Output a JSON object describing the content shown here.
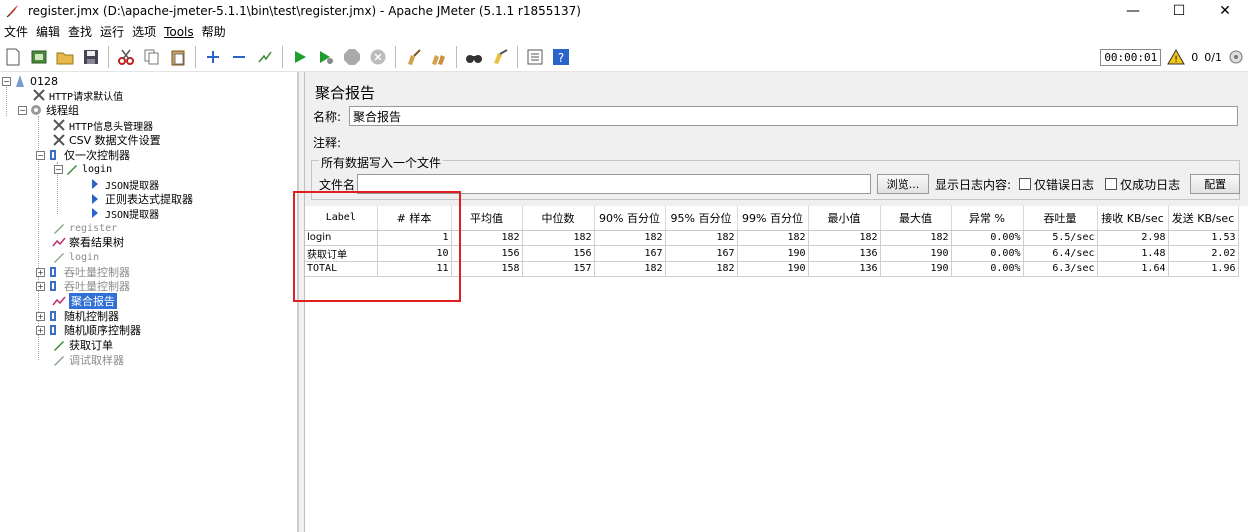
{
  "window": {
    "title": "register.jmx (D:\\apache-jmeter-5.1.1\\bin\\test\\register.jmx) - Apache JMeter (5.1.1 r1855137)",
    "minimize": "—",
    "maximize": "☐",
    "close": "✕"
  },
  "menu": [
    "文件",
    "编辑",
    "查找",
    "运行",
    "选项",
    "Tools",
    "帮助"
  ],
  "toolbar": {
    "elapsed": "00:00:01",
    "warnings": "0",
    "threads": "0/1"
  },
  "tree": {
    "root": "0128",
    "http_defaults": "HTTP请求默认值",
    "thread_group": "线程组",
    "header_manager": "HTTP信息头管理器",
    "csv_config": "CSV 数据文件设置",
    "once_only": "仅一次控制器",
    "login_sampler": "login",
    "json_extractor_1": "JSON提取器",
    "regex_extractor": "正则表达式提取器",
    "json_extractor_2": "JSON提取器",
    "register": "register",
    "view_results_tree": "察看结果树",
    "login_disabled": "login",
    "throughput_1": "吞吐量控制器",
    "throughput_2": "吞吐量控制器",
    "aggregate_report": "聚合报告",
    "random_controller": "随机控制器",
    "random_order": "随机顺序控制器",
    "get_order": "获取订单",
    "debug_sampler": "调试取样器"
  },
  "panel": {
    "title": "聚合报告",
    "name_label": "名称:",
    "name_value": "聚合报告",
    "comment_label": "注释:",
    "comment_value": "",
    "file_group": "所有数据写入一个文件",
    "filename_label": "文件名",
    "filename_value": "",
    "browse": "浏览...",
    "log_content": "显示日志内容:",
    "errors_only": "仅错误日志",
    "success_only": "仅成功日志",
    "configure": "配置"
  },
  "table": {
    "headers": [
      "Label",
      "# 样本",
      "平均值",
      "中位数",
      "90% 百分位",
      "95% 百分位",
      "99% 百分位",
      "最小值",
      "最大值",
      "异常 %",
      "吞吐量",
      "接收 KB/sec",
      "发送 KB/sec"
    ],
    "rows": [
      [
        "login",
        "1",
        "182",
        "182",
        "182",
        "182",
        "182",
        "182",
        "182",
        "0.00%",
        "5.5/sec",
        "2.98",
        "1.53"
      ],
      [
        "获取订单",
        "10",
        "156",
        "156",
        "167",
        "167",
        "190",
        "136",
        "190",
        "0.00%",
        "6.4/sec",
        "1.48",
        "2.02"
      ],
      [
        "TOTAL",
        "11",
        "158",
        "157",
        "182",
        "182",
        "190",
        "136",
        "190",
        "0.00%",
        "6.3/sec",
        "1.64",
        "1.96"
      ]
    ]
  },
  "colors": {
    "selection": "#2f6fd6",
    "annotation": "#e02020",
    "run_green": "#1f9d2f"
  }
}
